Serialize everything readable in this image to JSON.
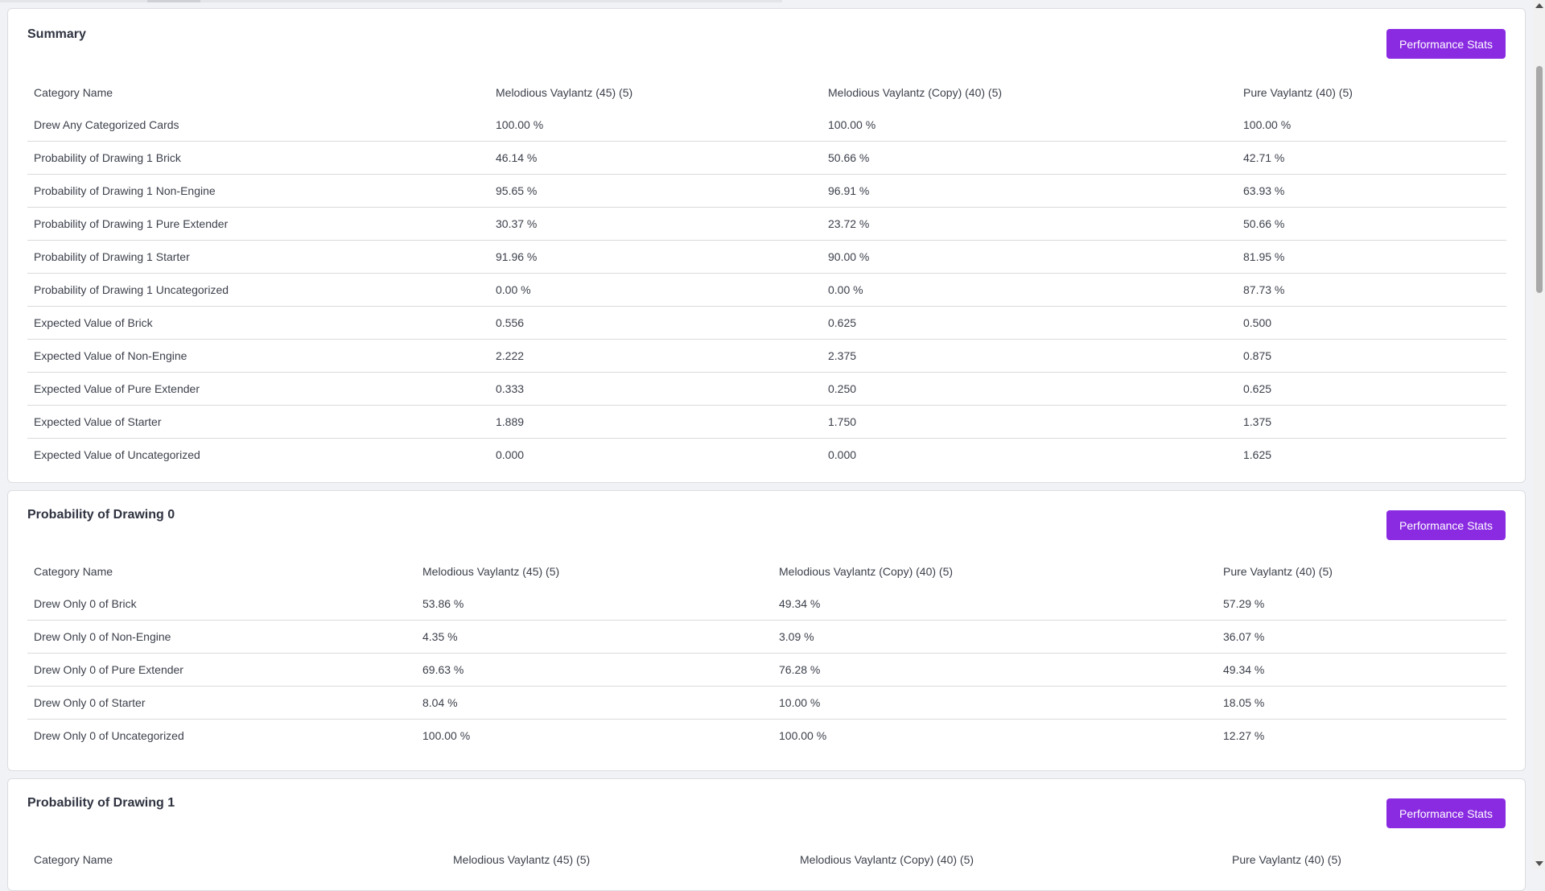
{
  "sections": [
    {
      "title": "Summary",
      "button_label": "Performance Stats",
      "headers": [
        "Category Name",
        "Melodious Vaylantz (45) (5)",
        "Melodious Vaylantz (Copy) (40) (5)",
        "Pure Vaylantz (40) (5)"
      ],
      "rows": [
        [
          "Drew Any Categorized Cards",
          "100.00 %",
          "100.00 %",
          "100.00 %"
        ],
        [
          "Probability of Drawing 1 Brick",
          "46.14 %",
          "50.66 %",
          "42.71 %"
        ],
        [
          "Probability of Drawing 1 Non-Engine",
          "95.65 %",
          "96.91 %",
          "63.93 %"
        ],
        [
          "Probability of Drawing 1 Pure Extender",
          "30.37 %",
          "23.72 %",
          "50.66 %"
        ],
        [
          "Probability of Drawing 1 Starter",
          "91.96 %",
          "90.00 %",
          "81.95 %"
        ],
        [
          "Probability of Drawing 1 Uncategorized",
          "0.00 %",
          "0.00 %",
          "87.73 %"
        ],
        [
          "Expected Value of Brick",
          "0.556",
          "0.625",
          "0.500"
        ],
        [
          "Expected Value of Non-Engine",
          "2.222",
          "2.375",
          "0.875"
        ],
        [
          "Expected Value of Pure Extender",
          "0.333",
          "0.250",
          "0.625"
        ],
        [
          "Expected Value of Starter",
          "1.889",
          "1.750",
          "1.375"
        ],
        [
          "Expected Value of Uncategorized",
          "0.000",
          "0.000",
          "1.625"
        ]
      ]
    },
    {
      "title": "Probability of Drawing 0",
      "button_label": "Performance Stats",
      "headers": [
        "Category Name",
        "Melodious Vaylantz (45) (5)",
        "Melodious Vaylantz (Copy) (40) (5)",
        "Pure Vaylantz (40) (5)"
      ],
      "rows": [
        [
          "Drew Only 0 of Brick",
          "53.86 %",
          "49.34 %",
          "57.29 %"
        ],
        [
          "Drew Only 0 of Non-Engine",
          "4.35 %",
          "3.09 %",
          "36.07 %"
        ],
        [
          "Drew Only 0 of Pure Extender",
          "69.63 %",
          "76.28 %",
          "49.34 %"
        ],
        [
          "Drew Only 0 of Starter",
          "8.04 %",
          "10.00 %",
          "18.05 %"
        ],
        [
          "Drew Only 0 of Uncategorized",
          "100.00 %",
          "100.00 %",
          "12.27 %"
        ]
      ]
    },
    {
      "title": "Probability of Drawing 1",
      "button_label": "Performance Stats",
      "headers": [
        "Category Name",
        "Melodious Vaylantz (45) (5)",
        "Melodious Vaylantz (Copy) (40) (5)",
        "Pure Vaylantz (40) (5)"
      ],
      "rows": []
    }
  ],
  "colors": {
    "accent": "#8a2be2",
    "page_background": "#f1f2f5",
    "card_background": "#ffffff",
    "text": "#3b3f4a",
    "row_divider": "#d9dade"
  }
}
